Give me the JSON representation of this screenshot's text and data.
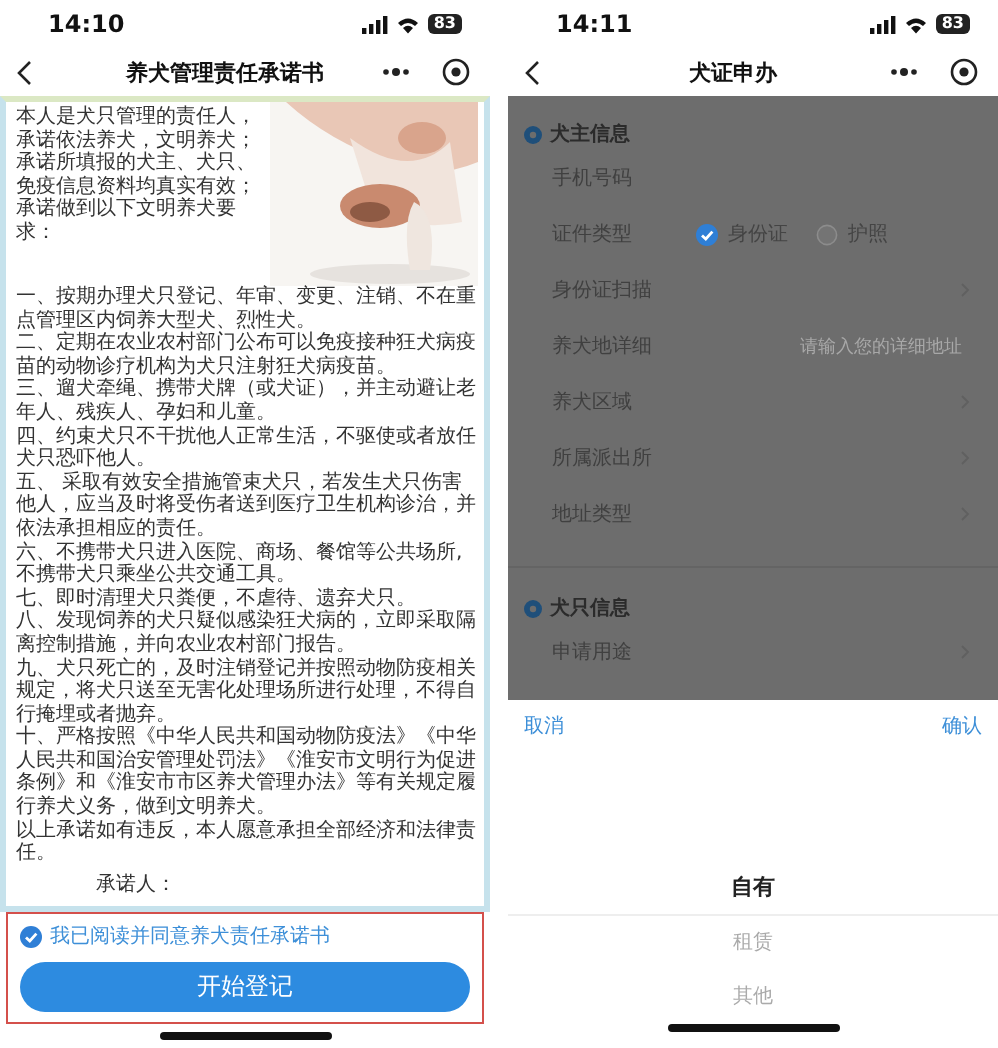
{
  "commitment_screen": {
    "status_bar": {
      "time": "14:10",
      "battery": "83"
    },
    "nav": {
      "title": "养犬管理责任承诺书"
    },
    "paragraphs": [
      "本人是犬只管理的责任人，承诺依法养犬，文明养犬；承诺所填报的犬主、犬只、免疫信息资料均真实有效；承诺做到以下文明养犬要求：",
      "一、按期办理犬只登记、年审、变更、注销、不在重点管理区内饲养大型犬、烈性犬。",
      "二、定期在农业农村部门公布可以免疫接种狂犬病疫苗的动物诊疗机构为犬只注射狂犬病疫苗。",
      "三、遛犬牵绳、携带犬牌（或犬证），并主动避让老年人、残疾人、孕妇和儿童。",
      "四、约束犬只不干扰他人正常生活，不驱使或者放任犬只恐吓他人。",
      "五、 采取有效安全措施管束犬只，若发生犬只伤害他人，应当及时将受伤者送到医疗卫生机构诊治，并依法承担相应的责任。",
      "六、不携带犬只进入医院、商场、餐馆等公共场所,不携带犬只乘坐公共交通工具。",
      "七、即时清理犬只粪便，不虐待、遗弃犬只。",
      "八、发现饲养的犬只疑似感染狂犬病的，立即采取隔离控制措施，并向农业农村部门报告。",
      "九、犬只死亡的，及时注销登记并按照动物防疫相关规定，将犬只送至无害化处理场所进行处理，不得自行掩埋或者抛弃。",
      "十、严格按照《中华人民共和国动物防疫法》《中华人民共和国治安管理处罚法》《淮安市文明行为促进条例》和《淮安市市区养犬管理办法》等有关规定履行养犬义务，做到文明养犬。",
      "以上承诺如有违反，本人愿意承担全部经济和法律责任。"
    ],
    "signer_label": "承诺人：",
    "agreement": {
      "label": "我已阅读并同意养犬责任承诺书",
      "checked": true
    },
    "start_button": "开始登记"
  },
  "application_screen": {
    "status_bar": {
      "time": "14:11",
      "battery": "83"
    },
    "nav": {
      "title": "犬证申办"
    },
    "sections": [
      {
        "title": "犬主信息",
        "rows": [
          {
            "kind": "input",
            "label": "手机号码"
          },
          {
            "kind": "radio",
            "label": "证件类型",
            "options": [
              {
                "label": "身份证",
                "selected": true
              },
              {
                "label": "护照",
                "selected": false
              }
            ]
          },
          {
            "kind": "select",
            "label": "身份证扫描"
          },
          {
            "kind": "input",
            "label": "养犬地详细",
            "placeholder": "请输入您的详细地址"
          },
          {
            "kind": "select",
            "label": "养犬区域"
          },
          {
            "kind": "select",
            "label": "所属派出所"
          },
          {
            "kind": "select",
            "label": "地址类型"
          }
        ]
      },
      {
        "title": "犬只信息",
        "rows": [
          {
            "kind": "select",
            "label": "申请用途"
          }
        ]
      }
    ],
    "picker": {
      "cancel": "取消",
      "confirm": "确认",
      "options": [
        {
          "label": "自有",
          "selected": true
        },
        {
          "label": "租赁",
          "selected": false
        },
        {
          "label": "其他",
          "selected": false
        }
      ]
    }
  }
}
